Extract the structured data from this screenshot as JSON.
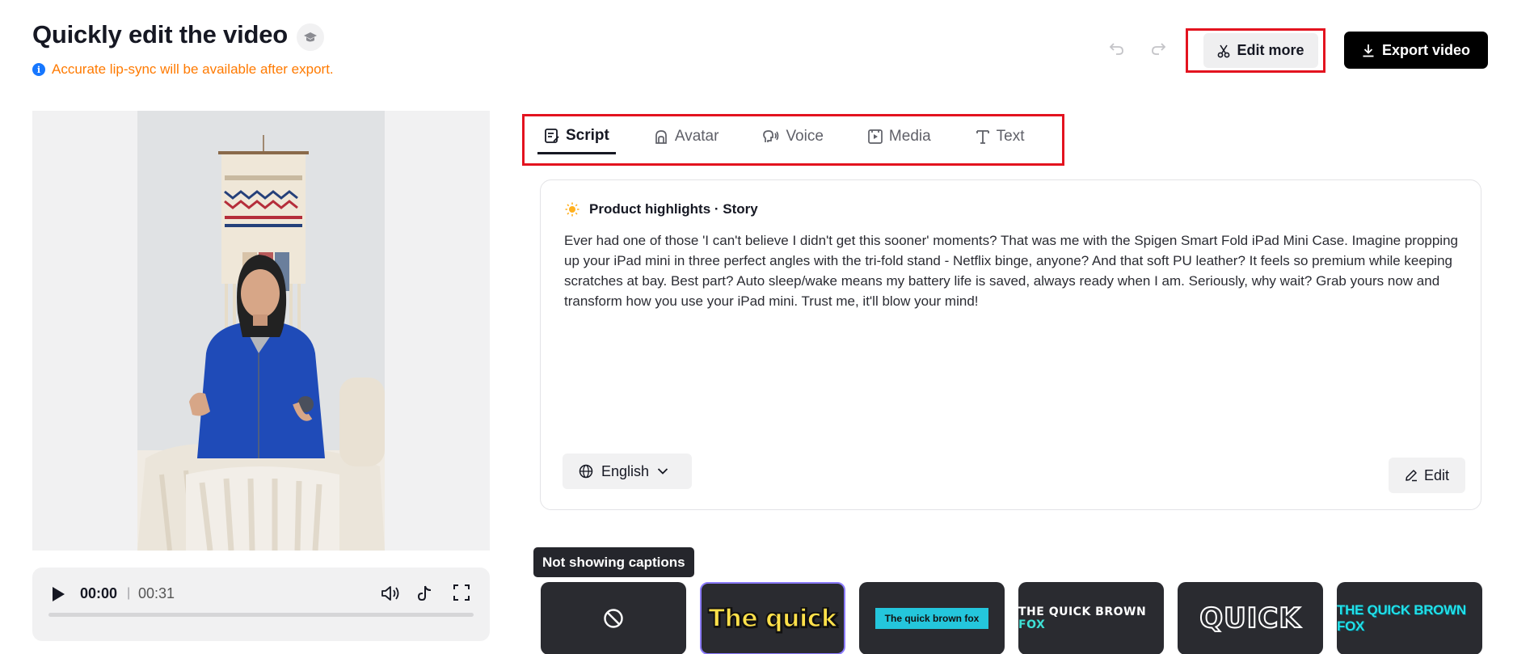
{
  "header": {
    "title": "Quickly edit the video",
    "notice": "Accurate lip-sync will be available after export."
  },
  "toolbar": {
    "edit_more_label": "Edit more",
    "export_label": "Export video"
  },
  "player": {
    "current_time": "00:00",
    "total_time": "00:31"
  },
  "tabs": [
    {
      "label": "Script",
      "icon": "script-icon",
      "active": true
    },
    {
      "label": "Avatar",
      "icon": "avatar-icon",
      "active": false
    },
    {
      "label": "Voice",
      "icon": "voice-icon",
      "active": false
    },
    {
      "label": "Media",
      "icon": "media-icon",
      "active": false
    },
    {
      "label": "Text",
      "icon": "text-icon",
      "active": false
    }
  ],
  "script": {
    "heading": "Product highlights · Story",
    "body": "Ever had one of those 'I can't believe I didn't get this sooner' moments? That was me with the Spigen Smart Fold iPad Mini Case. Imagine propping up your iPad mini in three perfect angles with the tri-fold stand - Netflix binge, anyone? And that soft PU leather? It feels so premium while keeping scratches at bay. Best part? Auto sleep/wake means my battery life is saved, always ready when I am. Seriously, why wait? Grab yours now and transform how you use your iPad mini. Trust me, it'll blow your mind!",
    "language": "English",
    "edit_label": "Edit"
  },
  "captions": {
    "tooltip": "Not showing captions",
    "styles": [
      {
        "preview": ""
      },
      {
        "preview": "The quick"
      },
      {
        "preview": "The quick brown fox"
      },
      {
        "preview_a": "THE QUICK BROWN ",
        "preview_b": "FOX"
      },
      {
        "preview": "QUICK"
      },
      {
        "preview": "THE QUICK BROWN FOX"
      }
    ]
  },
  "colors": {
    "accent": "#161823",
    "notice": "#ff7a00",
    "highlight_box": "#e3131f",
    "selected_caption": "#8b7bff"
  }
}
